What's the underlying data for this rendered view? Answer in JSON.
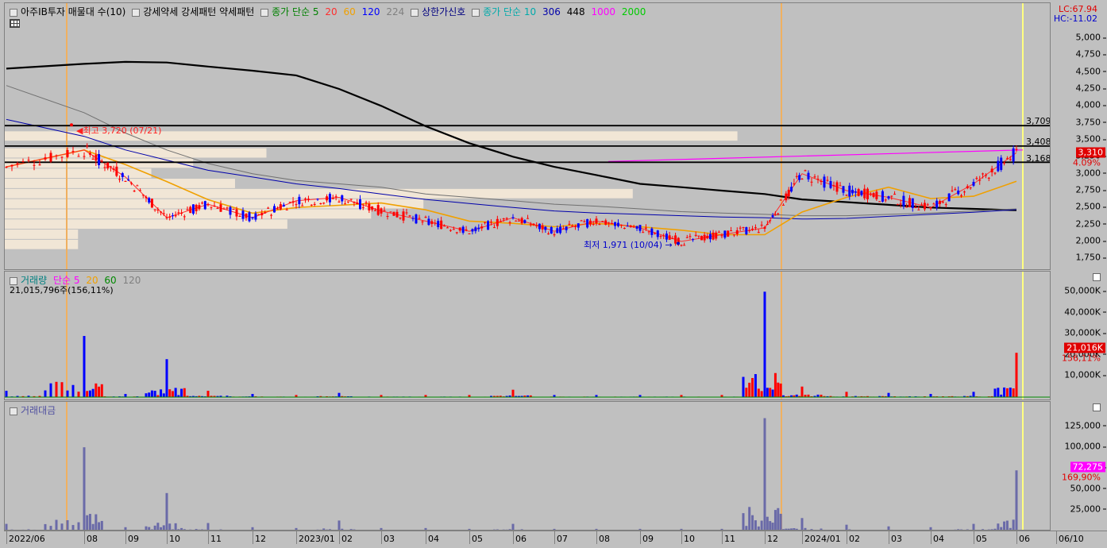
{
  "price_legend": {
    "title": "아주IB투자 매물대 수(10)",
    "strength": "강세약세 강세패턴  약세패턴",
    "ma_label": "종가 단순 5",
    "ma_periods": [
      "20",
      "60",
      "120",
      "224"
    ],
    "ma_colors": [
      "#ff2d2d",
      "#f0a000",
      "#0000ff",
      "#808080"
    ],
    "limit_signal": "상한가신호",
    "ma2_label": "종가 단순 10",
    "ma2_periods": [
      "306",
      "448",
      "1000",
      "2000"
    ],
    "ma2_colors": [
      "#0000aa",
      "#000000",
      "#ff00ff",
      "#00cc00"
    ]
  },
  "lc_hc": {
    "lc": "LC:67.94",
    "hc": "HC:-11.02"
  },
  "price_axis": [
    "5,000",
    "4,750",
    "4,500",
    "4,250",
    "4,000",
    "3,750",
    "3,500",
    "3,250",
    "3,000",
    "2,750",
    "2,500",
    "2,250",
    "2,000",
    "1,750"
  ],
  "price_levels": [
    {
      "label": "3,709",
      "value": 3709
    },
    {
      "label": "3,408",
      "value": 3408
    },
    {
      "label": "3,168",
      "value": 3168
    }
  ],
  "current_price": {
    "label": "3,310",
    "change": "4.09%",
    "color": "#e00000"
  },
  "high_annotation": "최고 3,720 (07/21)",
  "low_annotation": "최저 1,971 (10/04)",
  "vol_legend": {
    "label": "거래량",
    "ma": "단순 5",
    "periods": [
      "20",
      "60",
      "120"
    ],
    "colors": [
      "#ff00ff",
      "#f0a000",
      "#008800",
      "#808080"
    ],
    "summary": "21,015,796주(156,11%)"
  },
  "vol_axis": [
    "50,000K",
    "40,000K",
    "30,000K",
    "20,000K",
    "10,000K"
  ],
  "vol_current": {
    "label": "21,016K",
    "pct": "156,11%"
  },
  "amt_legend": {
    "label": "거래대금"
  },
  "amt_axis": [
    "125,000",
    "100,000",
    "75,000",
    "50,000",
    "25,000"
  ],
  "amt_current": {
    "label": "72,275",
    "pct": "169,90%"
  },
  "x_axis": [
    "2022/06",
    "08",
    "09",
    "10",
    "11",
    "12",
    "2023/01",
    "02",
    "03",
    "04",
    "05",
    "06",
    "07",
    "08",
    "09",
    "10",
    "11",
    "12",
    "2024/01",
    "02",
    "03",
    "04",
    "05",
    "06",
    "06/10"
  ],
  "chart_data": [
    {
      "type": "candlestick",
      "title": "아주IB투자 매물대 수(10)",
      "ylim": [
        1750,
        5000
      ],
      "x": [
        "2022/06",
        "08",
        "09",
        "10",
        "11",
        "12",
        "2023/01",
        "02",
        "03",
        "04",
        "05",
        "06",
        "07",
        "08",
        "09",
        "10",
        "11",
        "12",
        "2024/01",
        "02",
        "03",
        "04",
        "05",
        "06"
      ],
      "close_approx": [
        3100,
        3350,
        2950,
        2350,
        2550,
        2350,
        2600,
        2650,
        2450,
        2300,
        2150,
        2350,
        2150,
        2300,
        2200,
        2000,
        2100,
        2200,
        3000,
        2750,
        2650,
        2500,
        2850,
        3310
      ],
      "horizontal_levels": [
        3709,
        3408,
        3168
      ],
      "high": {
        "value": 3720,
        "date": "07/21"
      },
      "low": {
        "value": 1971,
        "date": "10/04"
      },
      "last": 3310,
      "change_pct": 4.09
    },
    {
      "type": "bar",
      "title": "거래량",
      "ylim": [
        0,
        55000
      ],
      "x": [
        "2022/06",
        "08",
        "09",
        "10",
        "11",
        "12",
        "2023/01",
        "02",
        "03",
        "04",
        "05",
        "06",
        "07",
        "08",
        "09",
        "10",
        "11",
        "12",
        "2024/01",
        "02",
        "03",
        "04",
        "05",
        "06"
      ],
      "peaks_approx": [
        3000,
        29000,
        1500,
        18000,
        3000,
        1500,
        1000,
        2000,
        1000,
        1000,
        1000,
        3500,
        1000,
        1000,
        1000,
        1000,
        1000,
        50000,
        5000,
        2500,
        2000,
        1500,
        2500,
        21016
      ],
      "last": 21016
    },
    {
      "type": "bar",
      "title": "거래대금",
      "ylim": [
        0,
        145000
      ],
      "x": [
        "2022/06",
        "08",
        "09",
        "10",
        "11",
        "12",
        "2023/01",
        "02",
        "03",
        "04",
        "05",
        "06",
        "07",
        "08",
        "09",
        "10",
        "11",
        "12",
        "2024/01",
        "02",
        "03",
        "04",
        "05",
        "06"
      ],
      "peaks_approx": [
        8000,
        100000,
        4000,
        45000,
        9000,
        4000,
        3000,
        12000,
        3000,
        3000,
        2000,
        8000,
        2000,
        2000,
        2000,
        2000,
        2000,
        135000,
        15000,
        7000,
        5000,
        4000,
        8000,
        72275
      ],
      "last": 72275
    }
  ]
}
